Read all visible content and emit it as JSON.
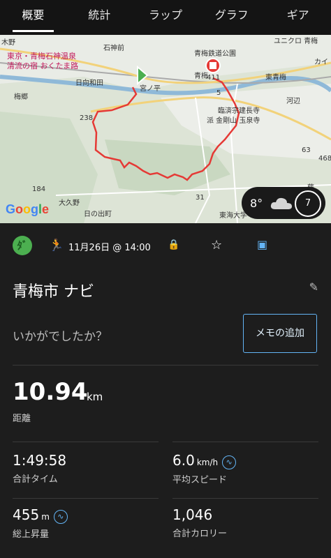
{
  "tabs": [
    "概要",
    "統計",
    "ラップ",
    "グラフ",
    "ギア"
  ],
  "map": {
    "labels": {
      "onsen_line1": "東京・青梅石神温泉",
      "onsen_line2": "清流の宿 おくたま路",
      "ishigamimae": "石神前",
      "hinatawada": "日向和田",
      "miyanohira": "宮ノ平",
      "umego": "梅郷",
      "oume_station": "青梅",
      "tetsudo_park": "青梅鉄道公園",
      "higashi_oume": "東青梅",
      "kawabe": "河辺",
      "temple_line1": "臨済宗建長寺",
      "temple_line2": "派 金剛山 玉泉寺",
      "okuno": "大久野",
      "hinode": "日の出町",
      "tokai_univ": "東海大学",
      "uniqlo": "ユニクロ 青梅",
      "kai": "カイ",
      "fuji": "藤",
      "kiba": "木野",
      "road_411": "411",
      "road_5": "5",
      "road_238": "238",
      "road_184": "184",
      "road_31": "31",
      "road_468": "468",
      "road_63": "63"
    },
    "google_logo": "Google",
    "weather": {
      "temp": "8°",
      "icon": "cloud-icon",
      "moon": "7"
    }
  },
  "activity": {
    "type_icon": "runner-icon",
    "badge_text": "ﾀﾞ",
    "date": "11月26日 @ 14:00",
    "title": "青梅市 ナビ",
    "prompt": "いかがでしたか？",
    "memo_button": "メモの追加"
  },
  "stats": {
    "distance": {
      "value": "10.94",
      "unit": "km",
      "label": "距離"
    },
    "total_time": {
      "value": "1:49:58",
      "label": "合計タイム"
    },
    "avg_speed": {
      "value": "6.0",
      "unit": "km/h",
      "label": "平均スピード"
    },
    "ascent": {
      "value": "455",
      "unit": "m",
      "label": "総上昇量"
    },
    "calories": {
      "value": "1,046",
      "label": "合計カロリー"
    }
  },
  "colors": {
    "accent": "#64b5f6",
    "route": "#e53935",
    "start": "#4caf50",
    "end": "#e53935"
  }
}
